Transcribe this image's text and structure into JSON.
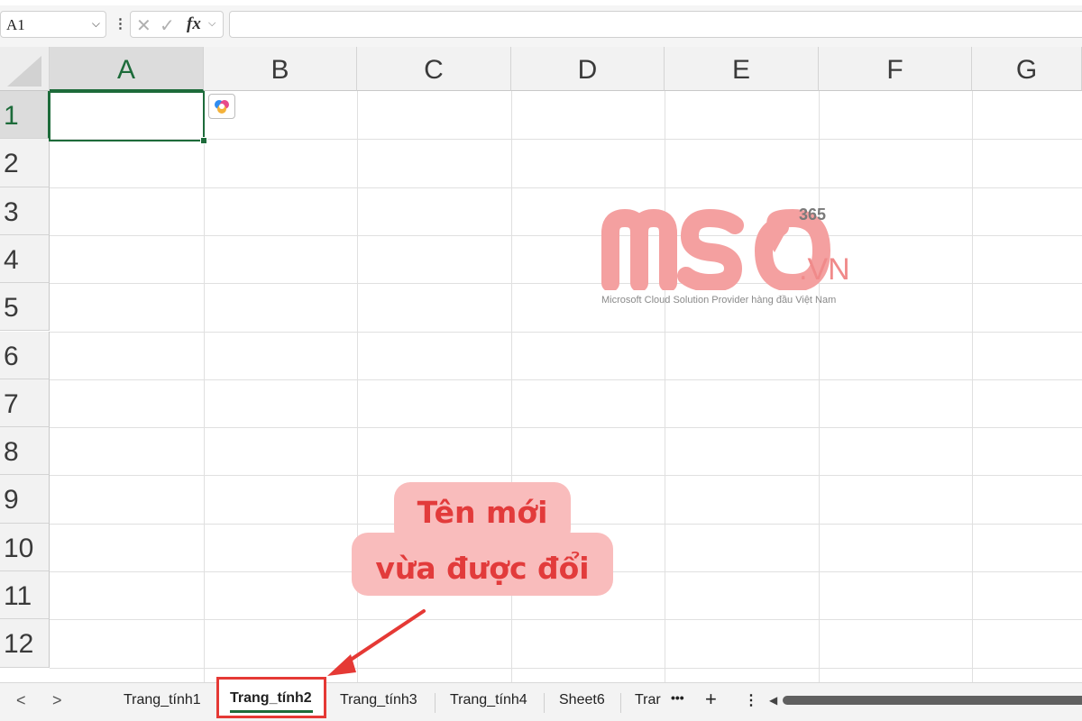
{
  "formula_bar": {
    "name_box": "A1",
    "fx_label": "fx",
    "cancel_glyph": "✕",
    "enter_glyph": "✓",
    "chevron_glyph": "⌄",
    "more_glyph": "⋮"
  },
  "columns": [
    "A",
    "B",
    "C",
    "D",
    "E",
    "F",
    "G"
  ],
  "rows": [
    "1",
    "2",
    "3",
    "4",
    "5",
    "6",
    "7",
    "8",
    "9",
    "10",
    "11",
    "12"
  ],
  "active_cell": "A1",
  "watermark": {
    "logo_text": "MSO",
    "superscript": "365",
    "suffix": ".VN",
    "tagline": "Microsoft Cloud Solution Provider hàng đầu Việt Nam"
  },
  "callout": {
    "line1": "Tên mới",
    "line2": "vừa được đổi"
  },
  "sheet_tabs": {
    "tabs": [
      "Trang_tính1",
      "Trang_tính2",
      "Trang_tính3",
      "Trang_tính4",
      "Sheet6",
      "Trar"
    ],
    "active_tab": "Trang_tính2",
    "overflow_glyph": "•••",
    "add_glyph": "+",
    "options_glyph": "⋮",
    "prev_glyph": "<",
    "next_glyph": ">"
  },
  "colors": {
    "accent_green": "#1d6b3a",
    "highlight_red": "#e53935",
    "callout_bg": "#f9bcbc",
    "callout_text": "#e23b3b",
    "watermark_pink": "#f08a8a"
  },
  "icons": [
    "chevron-down-icon",
    "cancel-icon",
    "enter-icon",
    "fx-icon",
    "copilot-icon",
    "arrow-icon",
    "add-sheet-icon",
    "options-icon"
  ]
}
